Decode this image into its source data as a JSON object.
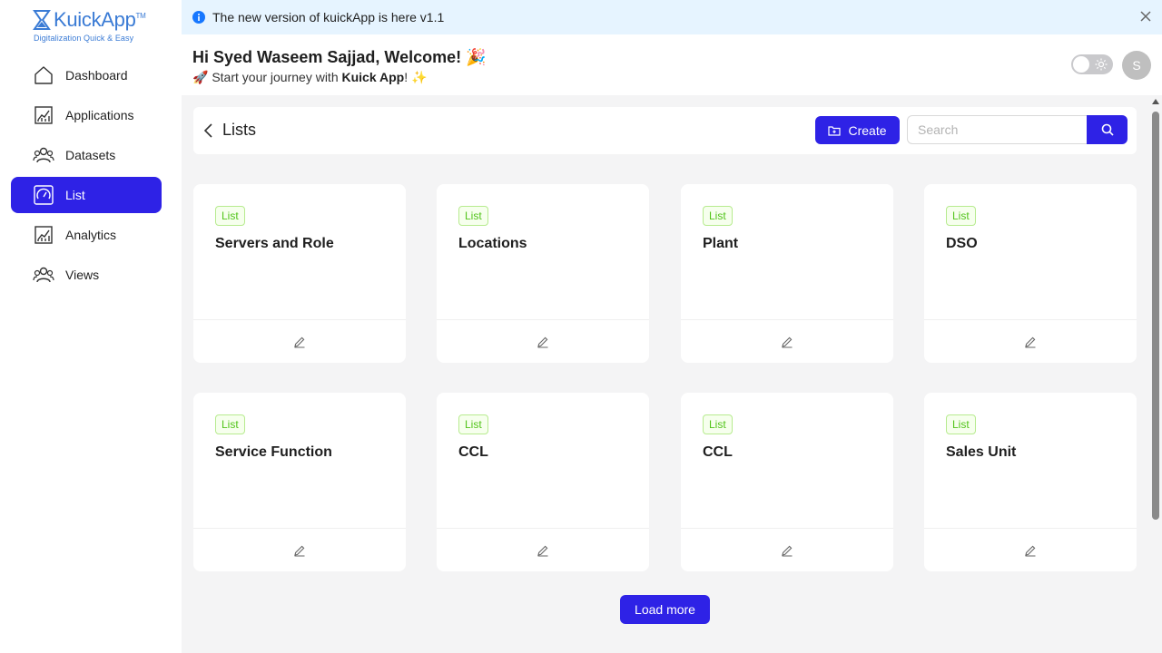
{
  "app": {
    "logo_name": "KuickApp",
    "logo_tm": "TM",
    "tagline": "Digitalization Quick & Easy",
    "brand_color": "#2e22e6"
  },
  "sidebar": {
    "items": [
      {
        "label": "Dashboard",
        "icon": "home-icon",
        "active": false
      },
      {
        "label": "Applications",
        "icon": "chart-icon",
        "active": false
      },
      {
        "label": "Datasets",
        "icon": "users-icon",
        "active": false
      },
      {
        "label": "List",
        "icon": "gauge-icon",
        "active": true
      },
      {
        "label": "Analytics",
        "icon": "chart-icon",
        "active": false
      },
      {
        "label": "Views",
        "icon": "users-icon",
        "active": false
      }
    ]
  },
  "banner": {
    "text": "The new version of kuickApp is here v1.1",
    "icon": "info-icon"
  },
  "header": {
    "greeting": "Hi Syed Waseem Sajjad, Welcome! 🎉",
    "sub_prefix": "🚀 Start your journey with ",
    "sub_bold": "Kuick App",
    "sub_suffix": "! ✨",
    "avatar_initial": "S"
  },
  "toolbar": {
    "title": "Lists",
    "create_label": "Create",
    "search_placeholder": "Search"
  },
  "cards": [
    {
      "tag": "List",
      "title": "Servers and Role"
    },
    {
      "tag": "List",
      "title": "Locations"
    },
    {
      "tag": "List",
      "title": "Plant"
    },
    {
      "tag": "List",
      "title": "DSO"
    },
    {
      "tag": "List",
      "title": "Service Function"
    },
    {
      "tag": "List",
      "title": "CCL"
    },
    {
      "tag": "List",
      "title": "CCL"
    },
    {
      "tag": "List",
      "title": "Sales Unit"
    }
  ],
  "load_more_label": "Load more"
}
